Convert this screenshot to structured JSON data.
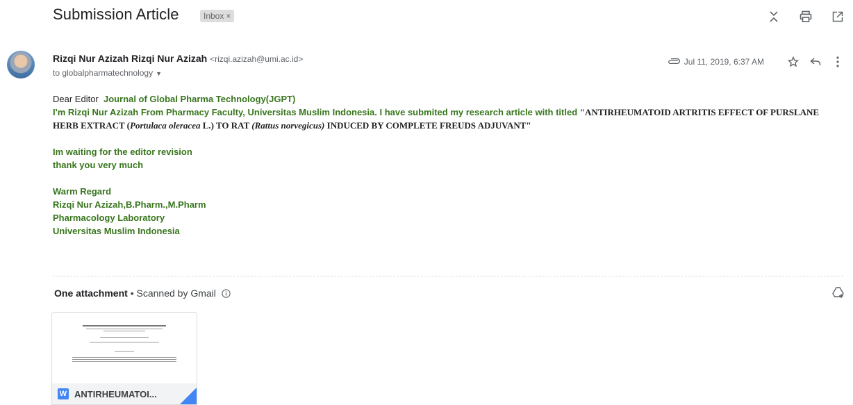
{
  "header": {
    "subject": "Submission Article",
    "label": "Inbox",
    "label_close": "×"
  },
  "message": {
    "sender_name": "Rizqi Nur Azizah Rizqi Nur Azizah",
    "sender_email": "<rizqi.azizah@umi.ac.id>",
    "to": "to globalpharmatechnology",
    "date": "Jul 11, 2019, 6:37 AM"
  },
  "body": {
    "greeting": "Dear Editor",
    "journal": "Journal of Global Pharma Technology(JGPT)",
    "intro": "I'm Rizqi Nur Azizah From Pharmacy Faculty, Universitas Muslim Indonesia. I have submited my research article with titled ",
    "title_part1": "\"ANTIRHEUMATOID ARTRITIS EFFECT OF PURSLANE HERB EXTRACT (",
    "title_italic1": "Portulaca oleracea",
    "title_part2": " L.) TO RAT ",
    "title_italic2": "(Rattus norvegicus)",
    "title_part3": " INDUCED BY COMPLETE FREUDS ADJUVANT\"",
    "line_waiting": "Im waiting for the editor revision",
    "line_thanks": "thank you very much",
    "sig1": "Warm Regard",
    "sig2": "Rizqi Nur Azizah,B.Pharm.,M.Pharm",
    "sig3": "Pharmacology Laboratory",
    "sig4": "Universitas Muslim Indonesia"
  },
  "attachments": {
    "heading": "One attachment",
    "scanned": " • Scanned by Gmail",
    "file_name": "ANTIRHEUMATOI...",
    "file_type_letter": "W"
  },
  "colors": {
    "green_text": "#38761d",
    "word_blue": "#4285f4"
  },
  "icons": [
    "collapse-icon",
    "print-icon",
    "open-new-window-icon",
    "attachment-clip-icon",
    "star-icon",
    "reply-icon",
    "more-vert-icon",
    "info-icon",
    "add-to-drive-icon",
    "word-doc-icon"
  ]
}
